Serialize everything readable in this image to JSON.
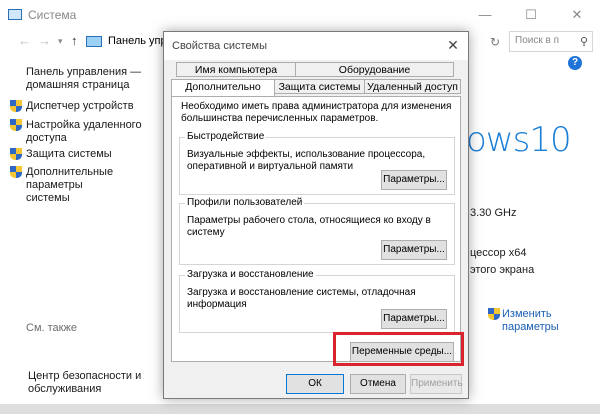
{
  "bg_window": {
    "title": "Система",
    "address": "Панель упр",
    "search_placeholder": "Поиск в п",
    "controls": {
      "minimize": "—",
      "maximize": "☐",
      "close": "✕"
    },
    "nav": {
      "back": "←",
      "forward": "→",
      "up": "↑",
      "refresh": "↻"
    },
    "help": "?"
  },
  "sidebar": {
    "home": "Панель управления —\nдомашняя страница",
    "items": [
      {
        "label": "Диспетчер устройств"
      },
      {
        "label": "Настройка удаленного\nдоступа"
      },
      {
        "label": "Защита системы"
      },
      {
        "label": "Дополнительные параметры\nсистемы"
      }
    ],
    "see_also": "См. также",
    "security_center": "Центр безопасности и\nобслуживания"
  },
  "right_panel": {
    "windows_logo": "ows10",
    "cpu_speed": "3.30 GHz",
    "cpu_arch": "цессор x64",
    "screen": "этого экрана",
    "change_params": "Изменить\nпараметры"
  },
  "dialog": {
    "title": "Свойства системы",
    "close": "✕",
    "tabs_top": [
      "Имя компьютера",
      "Оборудование"
    ],
    "tabs_bottom": [
      "Дополнительно",
      "Защита системы",
      "Удаленный доступ"
    ],
    "admin_note": "Необходимо иметь права администратора для изменения большинства перечисленных параметров.",
    "groups": [
      {
        "title": "Быстродействие",
        "desc": "Визуальные эффекты, использование процессора, оперативной и виртуальной памяти",
        "button": "Параметры..."
      },
      {
        "title": "Профили пользователей",
        "desc": "Параметры рабочего стола, относящиеся ко входу в систему",
        "button": "Параметры..."
      },
      {
        "title": "Загрузка и восстановление",
        "desc": "Загрузка и восстановление системы, отладочная информация",
        "button": "Параметры..."
      }
    ],
    "env_button": "Переменные среды...",
    "ok": "ОК",
    "cancel": "Отмена",
    "apply": "Применить"
  },
  "colors": {
    "accent": "#1a7fd6",
    "highlight": "#d9232d",
    "link": "#1a5fb4"
  }
}
